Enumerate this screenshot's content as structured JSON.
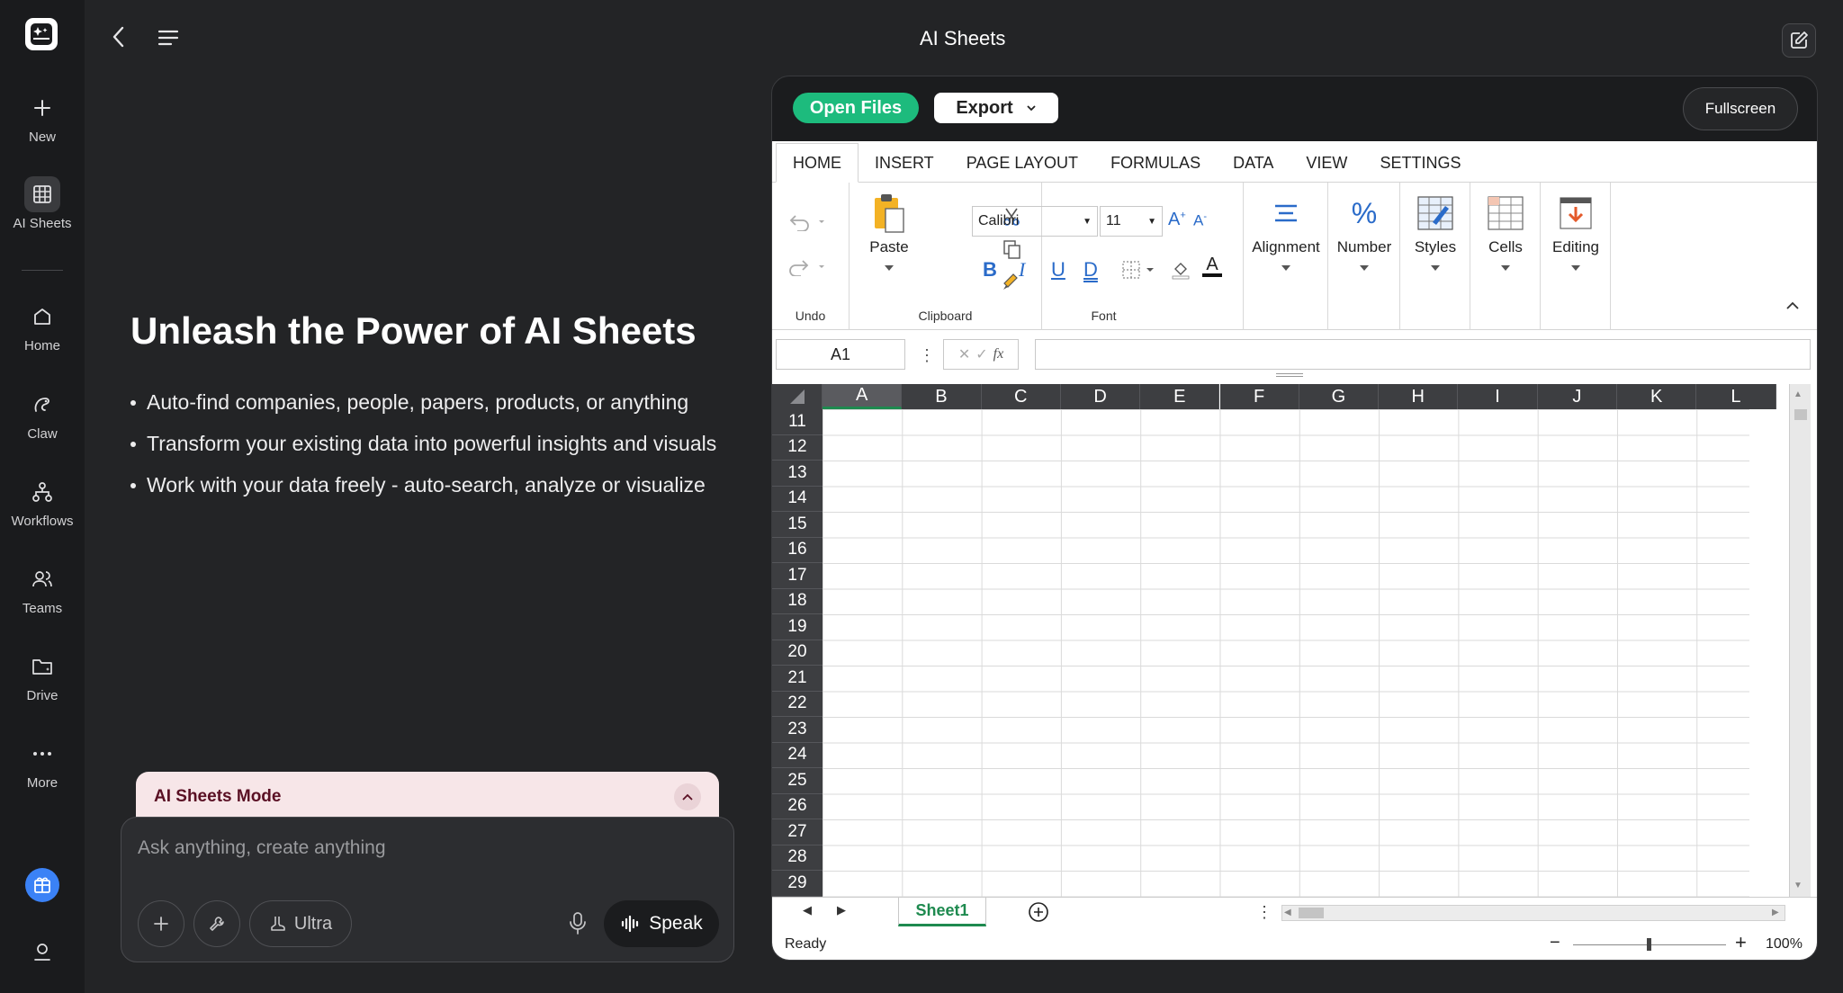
{
  "app": {
    "title": "AI Sheets"
  },
  "sidebar": {
    "items": [
      {
        "label": "New",
        "icon": "plus-icon"
      },
      {
        "label": "AI Sheets",
        "icon": "grid-icon"
      },
      {
        "label": "Home",
        "icon": "home-icon"
      },
      {
        "label": "Claw",
        "icon": "claw-icon"
      },
      {
        "label": "Workflows",
        "icon": "workflow-icon"
      },
      {
        "label": "Teams",
        "icon": "teams-icon"
      },
      {
        "label": "Drive",
        "icon": "drive-icon"
      },
      {
        "label": "More",
        "icon": "more-icon"
      }
    ]
  },
  "hero": {
    "title": "Unleash the Power of AI Sheets",
    "bullets": [
      "Auto-find companies, people, papers, products, or anything",
      "Transform your existing data into powerful insights and visuals",
      "Work with your data freely - auto-search, analyze or visualize"
    ]
  },
  "chat": {
    "mode_label": "AI Sheets Mode",
    "placeholder": "Ask anything, create anything",
    "ultra_label": "Ultra",
    "speak_label": "Speak"
  },
  "toolbar": {
    "open_files": "Open Files",
    "export": "Export",
    "fullscreen": "Fullscreen"
  },
  "excel": {
    "tabs": [
      "HOME",
      "INSERT",
      "PAGE LAYOUT",
      "FORMULAS",
      "DATA",
      "VIEW",
      "SETTINGS"
    ],
    "groups": {
      "undo": "Undo",
      "paste": "Paste",
      "clipboard": "Clipboard",
      "font": "Font",
      "alignment": "Alignment",
      "number": "Number",
      "styles": "Styles",
      "cells": "Cells",
      "editing": "Editing"
    },
    "font_name": "Calibri",
    "font_size": "11",
    "name_box": "A1",
    "fx": "fx",
    "columns": [
      "A",
      "B",
      "C",
      "D",
      "E",
      "F",
      "G",
      "H",
      "I",
      "J",
      "K",
      "L"
    ],
    "rows": [
      "11",
      "12",
      "13",
      "14",
      "15",
      "16",
      "17",
      "18",
      "19",
      "20",
      "21",
      "22",
      "23",
      "24",
      "25",
      "26",
      "27",
      "28",
      "29"
    ],
    "sheet_tab": "Sheet1",
    "status": "Ready",
    "zoom": "100%",
    "accent": "#1e8a4f"
  }
}
